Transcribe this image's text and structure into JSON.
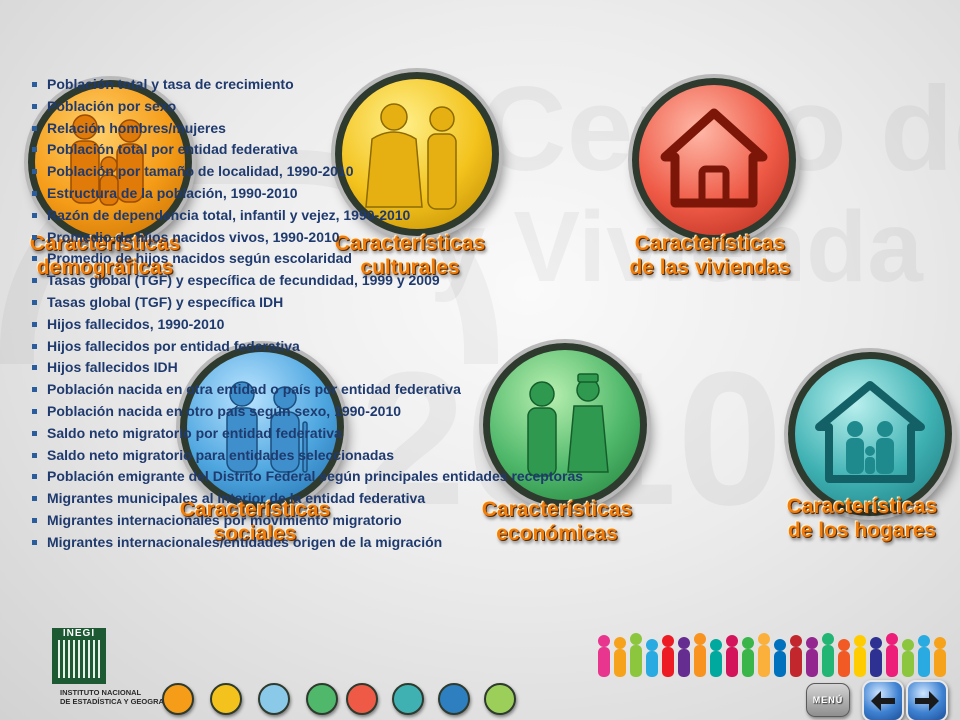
{
  "topics": {
    "demograficas": {
      "line1": "Características",
      "line2": "demográficas"
    },
    "culturales": {
      "line1": "Características",
      "line2": "culturales"
    },
    "viviendas": {
      "line1": "Características",
      "line2": "de las viviendas"
    },
    "sociales": {
      "line1": "Características",
      "line2": "sociales"
    },
    "economicas": {
      "line1": "Características",
      "line2": "económicas"
    },
    "hogares": {
      "line1": "Características",
      "line2": "de los hogares"
    }
  },
  "list": [
    "Población total y tasa de crecimiento",
    "Población por sexo",
    "Relación hombres/mujeres",
    "Población total por entidad federativa",
    "Población por tamaño de localidad, 1990-2010",
    "Estructura de la población, 1990-2010",
    "Razón de dependencia total, infantil y vejez, 1990-2010",
    "Promedio de hijos nacidos vivos, 1990-2010",
    "Promedio de hijos nacidos según escolaridad",
    "Tasas global (TGF) y específica de fecundidad, 1999 y 2009",
    "Tasas global (TGF) y específica IDH",
    "Hijos fallecidos, 1990-2010",
    "Hijos fallecidos por entidad federativa",
    "Hijos fallecidos IDH",
    "Población nacida en otra entidad o país por entidad federativa",
    "Población nacida en otro país según sexo, 1990-2010",
    "Saldo neto migratorio por entidad federativa",
    "Saldo neto migratorio para entidades seleccionadas",
    "Población emigrante del Distrito Federal según principales entidades receptoras",
    "Migrantes municipales al interior de la entidad federativa",
    "Migrantes internacionales por movimiento migratorio",
    "Migrantes internacionales/entidades origen de la migración"
  ],
  "watermark": {
    "line1": "Censo de Población",
    "line2": "y Vivienda",
    "line3": "2010"
  },
  "footer": {
    "logo_word": "INEGI",
    "institute_line1": "INSTITUTO NACIONAL",
    "institute_line2": "DE ESTADÍSTICA Y GEOGRAFÍA",
    "menu_label": "MENÚ"
  },
  "colors": {
    "caption": "#f07d0c",
    "list_text": "#1f3a6e",
    "demograficas": "#f59c18",
    "culturales": "#f3c21c",
    "viviendas": "#ee5a46",
    "sociales": "#4fa7e0",
    "economicas": "#4fb86a",
    "hogares": "#3fb1b3"
  },
  "icons": [
    "family-icon",
    "couple-icon",
    "house-icon",
    "elderly-icon",
    "workers-icon",
    "household-icon"
  ]
}
